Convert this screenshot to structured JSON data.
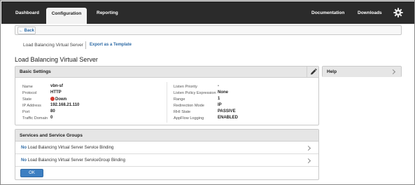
{
  "nav": {
    "tabs": [
      {
        "label": "Dashboard",
        "active": false
      },
      {
        "label": "Configuration",
        "active": true
      },
      {
        "label": "Reporting",
        "active": false
      }
    ],
    "right_links": [
      {
        "label": "Documentation"
      },
      {
        "label": "Downloads"
      }
    ],
    "settings_icon": "gear-icon"
  },
  "backbar": {
    "back_label": "← Back"
  },
  "breadcrumb": {
    "current": "Load Balancing Virtual Server",
    "export_link": "Export as a Template"
  },
  "page_title": "Load Balancing Virtual Server",
  "basic_settings": {
    "title": "Basic Settings",
    "left": [
      {
        "label": "Name",
        "value": "vbn-sf"
      },
      {
        "label": "Protocol",
        "value": "HTTP"
      },
      {
        "label": "State",
        "value": "Down",
        "status_color": "#d43a2f"
      },
      {
        "label": "IP Address",
        "value": "192.168.21.110"
      },
      {
        "label": "Port",
        "value": "80"
      },
      {
        "label": "Traffic Domain",
        "value": "0"
      }
    ],
    "right": [
      {
        "label": "Listen Priority",
        "value": "-"
      },
      {
        "label": "Listen Policy Expression",
        "value": "None"
      },
      {
        "label": "Range",
        "value": "1"
      },
      {
        "label": "Redirection Mode",
        "value": "IP"
      },
      {
        "label": "RHI State",
        "value": "PASSIVE"
      },
      {
        "label": "AppFlow Logging",
        "value": "ENABLED"
      }
    ]
  },
  "help": {
    "title": "Help"
  },
  "services": {
    "title": "Services and Service Groups",
    "rows": [
      {
        "prefix": "No",
        "text": "Load Balancing Virtual Server Service Binding"
      },
      {
        "prefix": "No",
        "text": "Load Balancing Virtual Server ServiceGroup Binding"
      }
    ],
    "ok_label": "OK"
  },
  "colors": {
    "topbar": "#2b2b2b",
    "link": "#2d6aa5",
    "primary_button": "#3d7fc2",
    "down_status": "#d43a2f"
  }
}
